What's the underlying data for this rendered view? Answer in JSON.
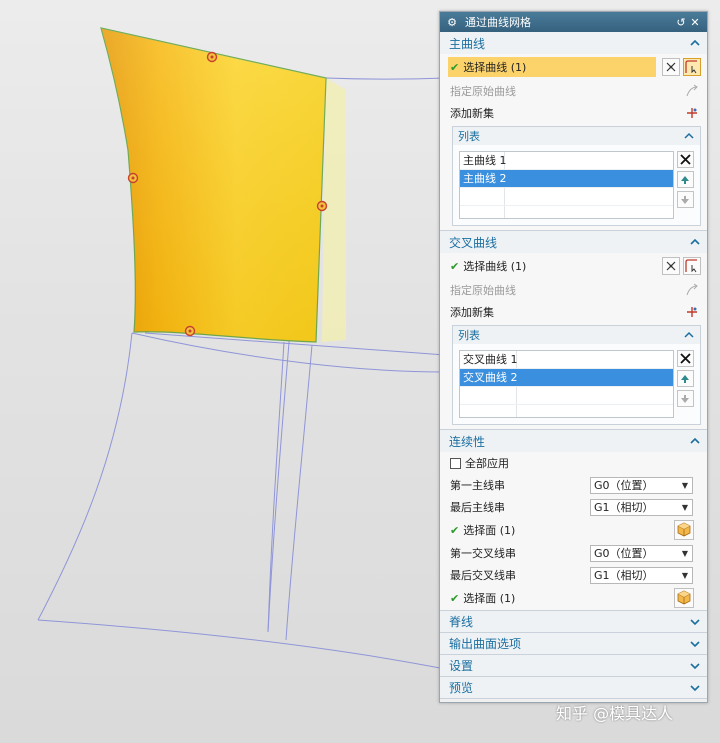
{
  "dialog": {
    "title": "通过曲线网格",
    "gear_icon": "gear-icon",
    "reset_icon": "reset-icon",
    "close_icon": "close-icon"
  },
  "primary_curves": {
    "header": "主曲线",
    "select_curve": "选择曲线 (1)",
    "specify_origin": "指定原始曲线",
    "add_new_set": "添加新集",
    "list": {
      "header": "列表",
      "items": [
        "主曲线 1",
        "主曲线 2"
      ],
      "selected_index": 1
    }
  },
  "cross_curves": {
    "header": "交叉曲线",
    "select_curve": "选择曲线 (1)",
    "specify_origin": "指定原始曲线",
    "add_new_set": "添加新集",
    "list": {
      "header": "列表",
      "items": [
        "交叉曲线 1",
        "交叉曲线 2"
      ],
      "selected_index": 1
    }
  },
  "continuity": {
    "header": "连续性",
    "apply_all": "全部应用",
    "apply_all_checked": false,
    "first_primary_label": "第一主线串",
    "first_primary_value": "G0（位置）",
    "last_primary_label": "最后主线串",
    "last_primary_value": "G1（相切）",
    "select_face_1": "选择面 (1)",
    "first_cross_label": "第一交叉线串",
    "first_cross_value": "G0（位置）",
    "last_cross_label": "最后交叉线串",
    "last_cross_value": "G1（相切）",
    "select_face_2": "选择面 (1)"
  },
  "collapsed_groups": {
    "spine": "脊线",
    "output_surface": "输出曲面选项",
    "settings": "设置",
    "preview": "预览"
  },
  "watermark": "知乎 @模具达人",
  "colors": {
    "title_bar": "#3f7090",
    "group_header_text": "#1b6fa0",
    "selection_highlight": "#fcd36b",
    "list_selection": "#3a8fde",
    "surface_yellow": "#f7c317"
  }
}
